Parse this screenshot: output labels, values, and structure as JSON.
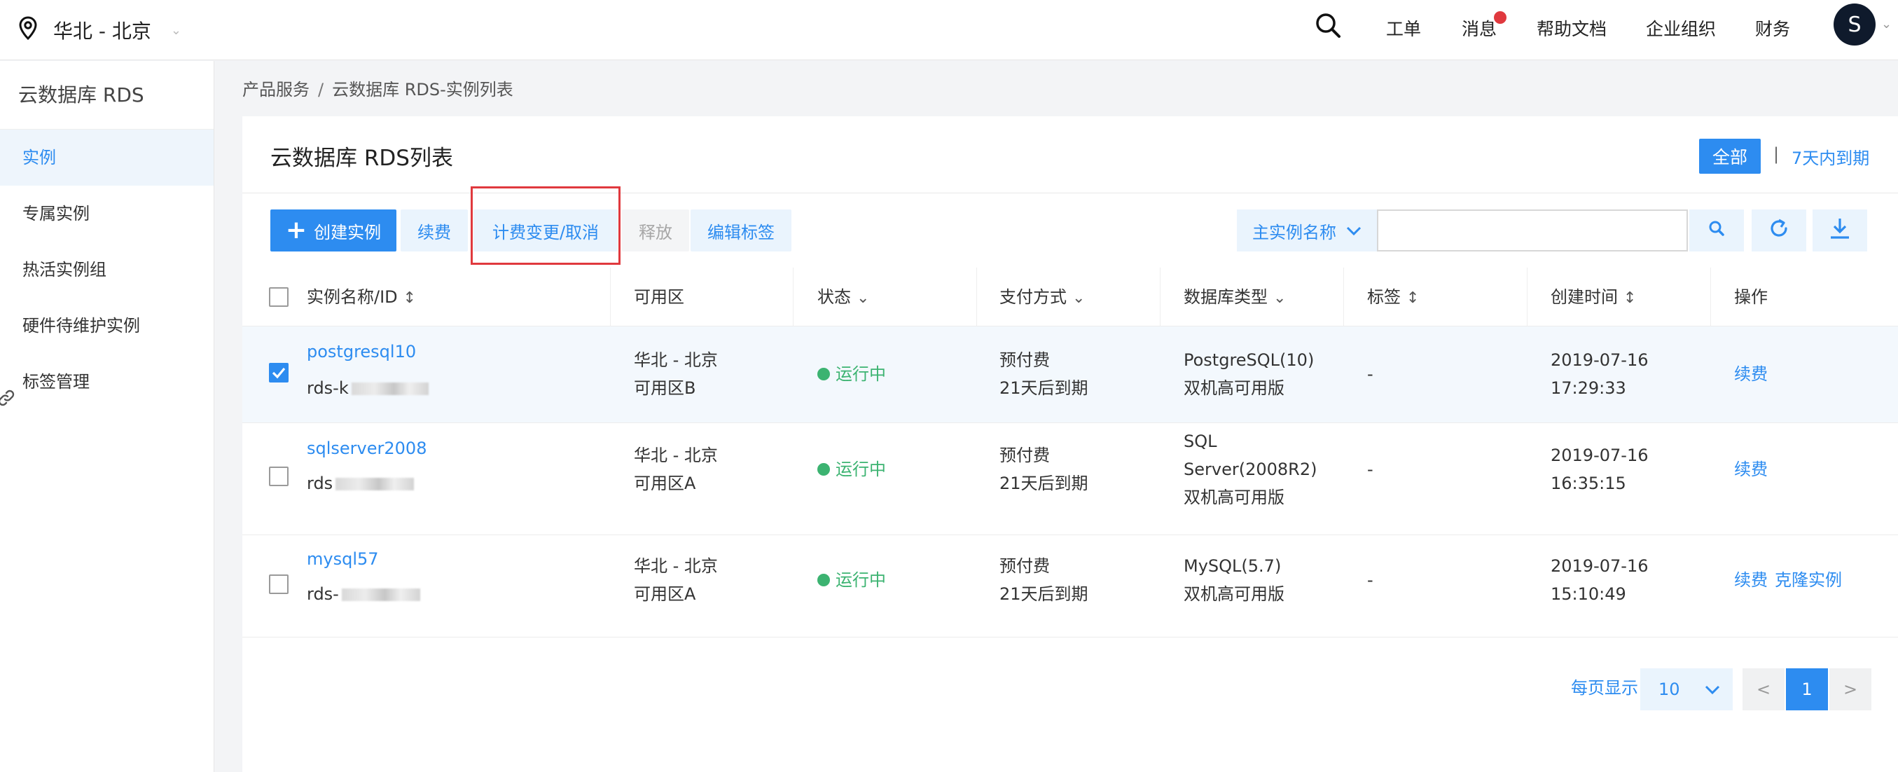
{
  "topbar": {
    "region": "华北 - 北京",
    "nav": {
      "ticket": "工单",
      "messages": "消息",
      "docs": "帮助文档",
      "org": "企业组织",
      "finance": "财务"
    },
    "avatar_letter": "S"
  },
  "sidebar": {
    "title": "云数据库 RDS",
    "items": [
      {
        "label": "实例"
      },
      {
        "label": "专属实例"
      },
      {
        "label": "热活实例组"
      },
      {
        "label": "硬件待维护实例"
      },
      {
        "label": "标签管理"
      }
    ]
  },
  "breadcrumb": {
    "root": "产品服务",
    "separator": "/",
    "current": "云数据库 RDS-实例列表"
  },
  "main": {
    "title": "云数据库 RDS列表",
    "filter_all": "全部",
    "filter_sep": "|",
    "filter_expiring": "7天内到期"
  },
  "toolbar": {
    "create_label": "创建实例",
    "renew_label": "续费",
    "billing_label": "计费变更/取消",
    "release_label": "释放",
    "edit_tags_label": "编辑标签",
    "search_field_label": "主实例名称",
    "search_value": ""
  },
  "table": {
    "headers": {
      "name": "实例名称/ID",
      "zone": "可用区",
      "status": "状态",
      "payment": "支付方式",
      "db_type": "数据库类型",
      "tags": "标签",
      "created": "创建时间",
      "actions": "操作"
    },
    "rows": [
      {
        "name": "postgresql10",
        "id": "rds-k",
        "zone1": "华北 - 北京",
        "zone2": "可用区B",
        "status": "运行中",
        "pay1": "预付费",
        "pay2": "21天后到期",
        "db1": "PostgreSQL(10)",
        "db2": "双机高可用版",
        "db3": "",
        "tags": "-",
        "date": "2019-07-16",
        "time": "17:29:33",
        "action1": "续费",
        "action2": "",
        "checked": true
      },
      {
        "name": "sqlserver2008",
        "id": "rds",
        "zone1": "华北 - 北京",
        "zone2": "可用区A",
        "status": "运行中",
        "pay1": "预付费",
        "pay2": "21天后到期",
        "db1": "SQL",
        "db2": "Server(2008R2)",
        "db3": "双机高可用版",
        "tags": "-",
        "date": "2019-07-16",
        "time": "16:35:15",
        "action1": "续费",
        "action2": "",
        "checked": false
      },
      {
        "name": "mysql57",
        "id": "rds-",
        "zone1": "华北 - 北京",
        "zone2": "可用区A",
        "status": "运行中",
        "pay1": "预付费",
        "pay2": "21天后到期",
        "db1": "MySQL(5.7)",
        "db2": "双机高可用版",
        "db3": "",
        "tags": "-",
        "date": "2019-07-16",
        "time": "15:10:49",
        "action1": "续费",
        "action2": "克隆实例",
        "checked": false
      }
    ]
  },
  "pagination": {
    "per_page_label": "每页显示",
    "per_page_value": "10",
    "prev": "<",
    "current": "1",
    "next": ">"
  },
  "colors": {
    "accent": "#2d8cf0",
    "running": "#3cb371",
    "highlight": "#e0393e"
  }
}
